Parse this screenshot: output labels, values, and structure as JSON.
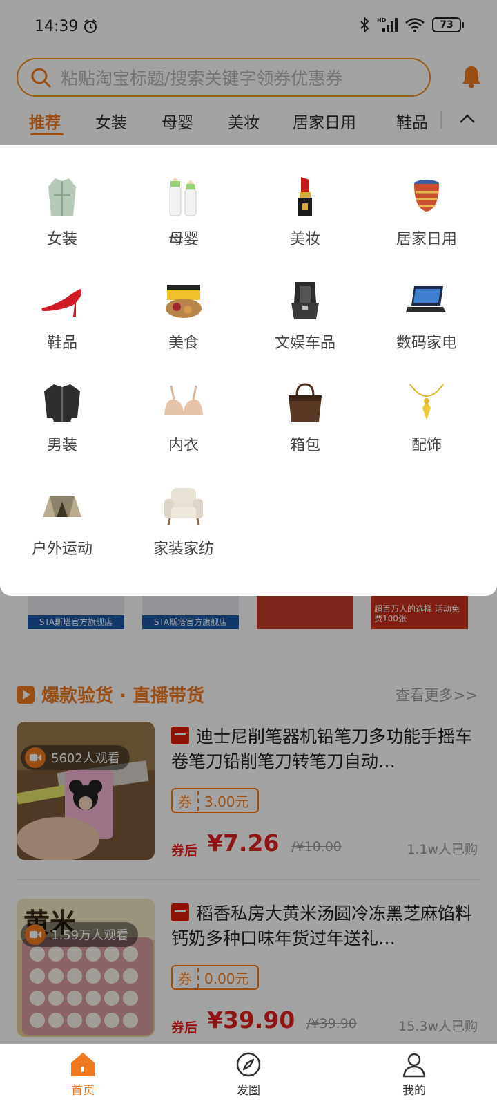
{
  "status_bar": {
    "time": "14:39",
    "battery": "73"
  },
  "search": {
    "placeholder": "粘贴淘宝标题/搜索关键字领券优惠券"
  },
  "tabs": [
    "推荐",
    "女装",
    "母婴",
    "美妆",
    "居家日用",
    "鞋品"
  ],
  "categories": [
    {
      "label": "女装",
      "icon": "coat-icon"
    },
    {
      "label": "母婴",
      "icon": "baby-bottle-icon"
    },
    {
      "label": "美妆",
      "icon": "lipstick-icon"
    },
    {
      "label": "居家日用",
      "icon": "bowl-icon"
    },
    {
      "label": "鞋品",
      "icon": "high-heel-icon"
    },
    {
      "label": "美食",
      "icon": "snack-box-icon"
    },
    {
      "label": "文娱车品",
      "icon": "car-seat-icon"
    },
    {
      "label": "数码家电",
      "icon": "laptop-icon"
    },
    {
      "label": "男装",
      "icon": "jacket-icon"
    },
    {
      "label": "内衣",
      "icon": "bra-icon"
    },
    {
      "label": "箱包",
      "icon": "handbag-icon"
    },
    {
      "label": "配饰",
      "icon": "necklace-icon"
    },
    {
      "label": "户外运动",
      "icon": "tent-icon"
    },
    {
      "label": "家装家纺",
      "icon": "armchair-icon"
    }
  ],
  "banners": {
    "store1": "STA斯塔官方旗舰店",
    "store2": "STA斯塔官方旗舰店",
    "promo": "超百万人的选择 活动免费100张"
  },
  "section": {
    "title": "爆款验货 · 直播带货",
    "more": "查看更多>>"
  },
  "products": [
    {
      "viewers": "5602人观看",
      "title": "迪士尼削笔器机铅笔刀多功能手摇车卷笔刀铅削笔刀转笔刀自动…",
      "coupon_label": "券",
      "coupon_value": "3.00元",
      "after_label": "券后",
      "price": "¥7.26",
      "original_price": "/¥10.00",
      "sold": "1.1w人已购"
    },
    {
      "viewers": "1.59万人观看",
      "title": "稻香私房大黄米汤圆冷冻黑芝麻馅料钙奶多种口味年货过年送礼…",
      "coupon_label": "券",
      "coupon_value": "0.00元",
      "after_label": "券后",
      "price": "¥39.90",
      "original_price": "/¥39.90",
      "sold": "15.3w人已购"
    }
  ],
  "nav": [
    {
      "label": "首页",
      "icon": "home-icon"
    },
    {
      "label": "发圈",
      "icon": "compass-icon"
    },
    {
      "label": "我的",
      "icon": "user-icon"
    }
  ],
  "colors": {
    "accent": "#f07a20",
    "price": "#e02020"
  }
}
